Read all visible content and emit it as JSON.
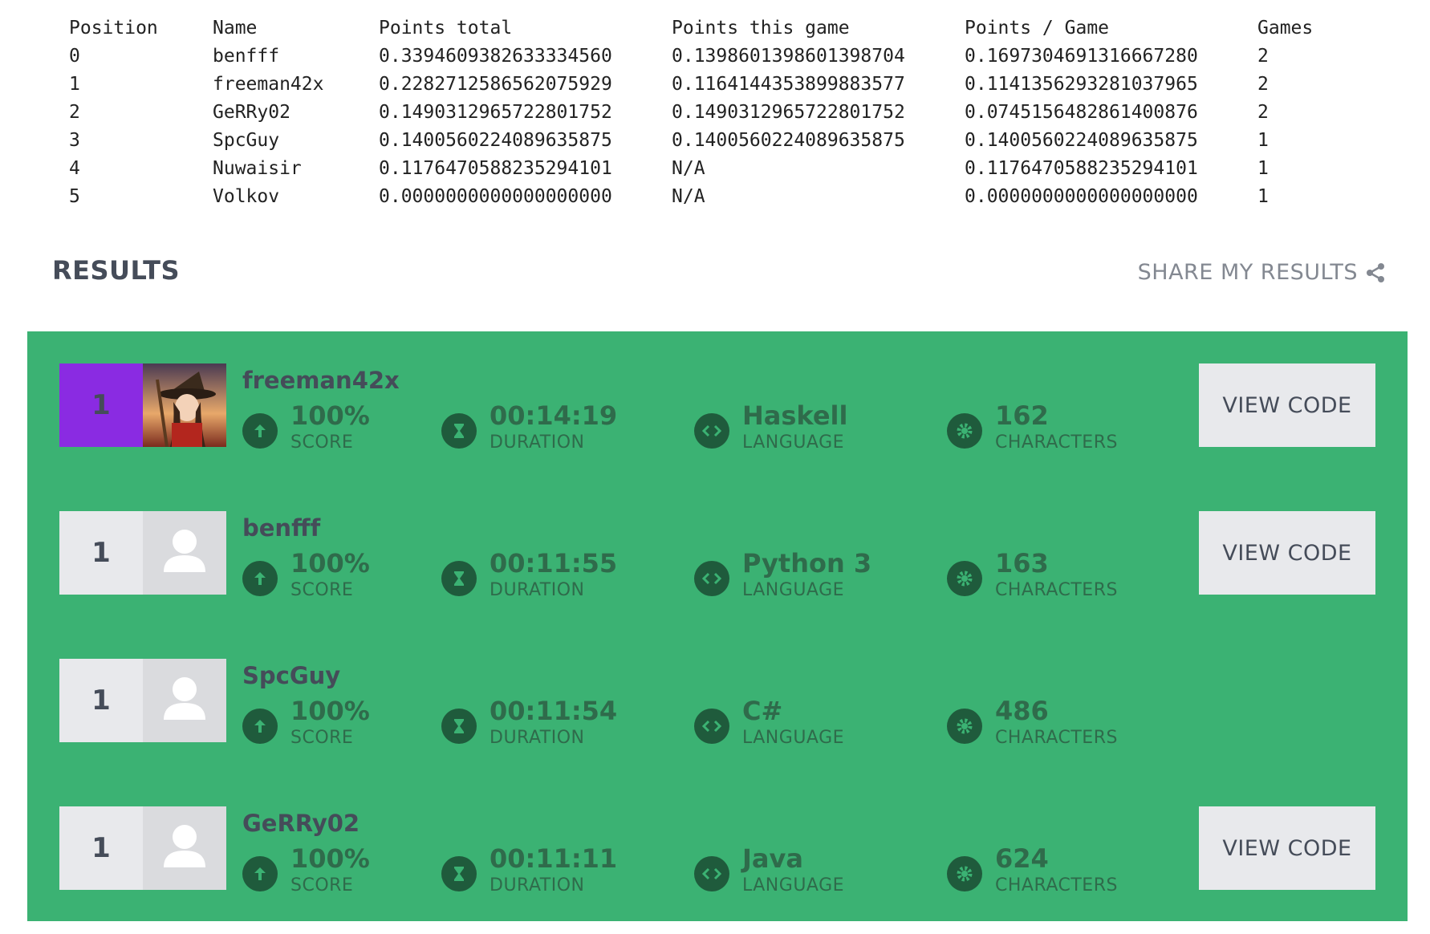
{
  "leaderboard": {
    "headers": [
      "Position",
      "Name",
      "Points total",
      "Points this game",
      "Points / Game",
      "Games"
    ],
    "rows": [
      [
        "0",
        "benfff",
        "0.3394609382633334560",
        "0.1398601398601398704",
        "0.1697304691316667280",
        "2"
      ],
      [
        "1",
        "freeman42x",
        "0.2282712586562075929",
        "0.1164144353899883577",
        "0.1141356293281037965",
        "2"
      ],
      [
        "2",
        "GeRRy02",
        "0.1490312965722801752",
        "0.1490312965722801752",
        "0.0745156482861400876",
        "2"
      ],
      [
        "3",
        "SpcGuy",
        "0.1400560224089635875",
        "0.1400560224089635875",
        "0.1400560224089635875",
        "1"
      ],
      [
        "4",
        "Nuwaisir",
        "0.1176470588235294101",
        "N/A",
        "0.1176470588235294101",
        "1"
      ],
      [
        "5",
        "Volkov",
        "0.0000000000000000000",
        "N/A",
        "0.0000000000000000000",
        "1"
      ]
    ]
  },
  "results": {
    "title": "RESULTS",
    "share_label": "SHARE MY RESULTS",
    "labels": {
      "score": "SCORE",
      "duration": "DURATION",
      "language": "LANGUAGE",
      "characters": "CHARACTERS",
      "view_code": "VIEW CODE"
    },
    "players": [
      {
        "rank": "1",
        "name": "freeman42x",
        "score": "100%",
        "duration": "00:14:19",
        "language": "Haskell",
        "characters": "162",
        "has_view_code": true
      },
      {
        "rank": "1",
        "name": "benfff",
        "score": "100%",
        "duration": "00:11:55",
        "language": "Python 3",
        "characters": "163",
        "has_view_code": true
      },
      {
        "rank": "1",
        "name": "SpcGuy",
        "score": "100%",
        "duration": "00:11:54",
        "language": "C#",
        "characters": "486",
        "has_view_code": false
      },
      {
        "rank": "1",
        "name": "GeRRy02",
        "score": "100%",
        "duration": "00:11:11",
        "language": "Java",
        "characters": "624",
        "has_view_code": true
      }
    ]
  },
  "colors": {
    "panel_green": "#3bb273",
    "first_rank": "#8a2be2",
    "icon_bg": "#1f5b3c"
  }
}
